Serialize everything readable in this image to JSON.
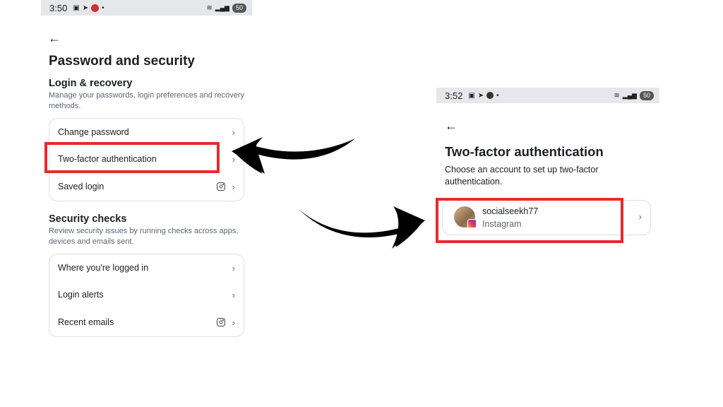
{
  "left_screen": {
    "status_time": "3:50",
    "status_battery": "50",
    "title": "Password and security",
    "login_section": {
      "heading": "Login & recovery",
      "description": "Manage your passwords, login preferences and recovery methods.",
      "items": [
        {
          "label": "Change password"
        },
        {
          "label": "Two-factor authentication"
        },
        {
          "label": "Saved login"
        }
      ]
    },
    "security_section": {
      "heading": "Security checks",
      "description": "Review security issues by running checks across apps, devices and emails sent.",
      "items": [
        {
          "label": "Where you're logged in"
        },
        {
          "label": "Login alerts"
        },
        {
          "label": "Recent emails"
        }
      ]
    }
  },
  "right_screen": {
    "status_time": "3:52",
    "status_battery": "50",
    "title": "Two-factor authentication",
    "description": "Choose an account to set up two-factor authentication.",
    "account": {
      "username": "socialseekh77",
      "platform": "Instagram"
    }
  },
  "colors": {
    "highlight": "#e8292e",
    "arrow": "#000000"
  }
}
